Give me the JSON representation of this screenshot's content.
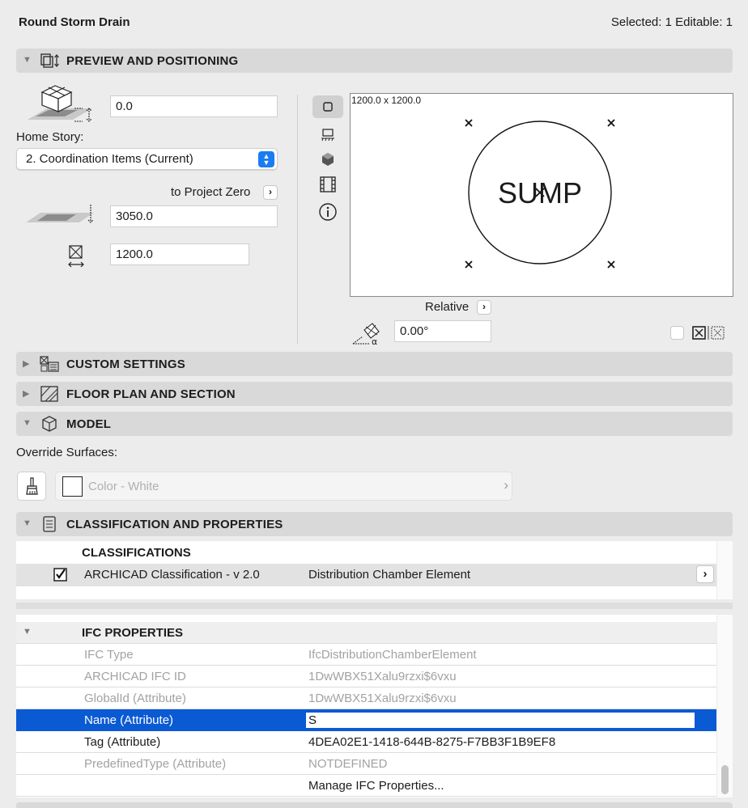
{
  "window": {
    "title": "Round Storm Drain",
    "selection": "Selected: 1 Editable: 1"
  },
  "sections": {
    "preview": "PREVIEW AND POSITIONING",
    "custom": "CUSTOM SETTINGS",
    "floorplan": "FLOOR PLAN AND SECTION",
    "model": "MODEL",
    "classification": "CLASSIFICATION AND PROPERTIES"
  },
  "positioning": {
    "offset_value": "0.0",
    "home_story_label": "Home Story:",
    "home_story_value": "2. Coordination Items (Current)",
    "to_project_zero_label": "to Project Zero",
    "elevation_value": "3050.0",
    "size_value": "1200.0",
    "preview_dimensions": "1200.0 x 1200.0",
    "preview_text": "SUMP",
    "relative_label": "Relative",
    "angle_value": "0.00°"
  },
  "model": {
    "override_label": "Override Surfaces:",
    "surface_value": "Color - White"
  },
  "classifications": {
    "header": "CLASSIFICATIONS",
    "system": "ARCHICAD Classification - v 2.0",
    "value": "Distribution Chamber Element"
  },
  "ifc": {
    "header": "IFC PROPERTIES",
    "rows": [
      {
        "key": "IFC Type",
        "value": "IfcDistributionChamberElement"
      },
      {
        "key": "ARCHICAD IFC ID",
        "value": "1DwWBX51Xalu9rzxi$6vxu"
      },
      {
        "key": "GlobalId (Attribute)",
        "value": "1DwWBX51Xalu9rzxi$6vxu"
      },
      {
        "key": "Name (Attribute)",
        "value": "S"
      },
      {
        "key": "Tag (Attribute)",
        "value": "4DEA02E1-1418-644B-8275-F7BB3F1B9EF8"
      },
      {
        "key": "PredefinedType (Attribute)",
        "value": "NOTDEFINED"
      }
    ],
    "manage_label": "Manage IFC Properties..."
  },
  "colors": {
    "accent": "#1b7cf2",
    "selected_row": "#0a5ad4",
    "header_bg": "#d9d9d9"
  }
}
